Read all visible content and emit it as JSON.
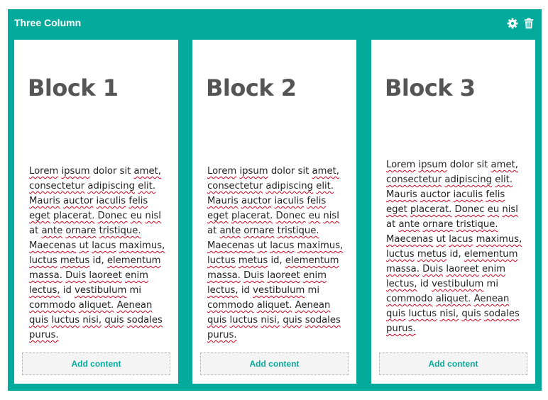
{
  "colors": {
    "accent": "#04ab9c",
    "spellcheck": "#d0021b"
  },
  "panel": {
    "title": "Three Column",
    "icons": [
      "gear-icon",
      "trash-icon"
    ]
  },
  "columns": [
    {
      "heading": "Block 1",
      "add_label": "Add content",
      "words": [
        "Lorem",
        "ipsum",
        "dolor",
        "sit",
        "amet,",
        "consectetur",
        "adipiscing",
        "elit.",
        "Mauris",
        "auctor",
        "iaculis",
        "felis",
        "eget",
        "placerat.",
        "Donec",
        "eu",
        "nisl",
        "at",
        "ante",
        "ornare",
        "tristique.",
        "Maecenas",
        "ut",
        "lacus",
        "maximus,",
        "luctus",
        "metus",
        "id,",
        "elementum",
        "massa.",
        "Duis",
        "laoreet",
        "enim",
        "lectus,",
        "id",
        "vestibulum",
        "mi",
        "commodo",
        "aliquet.",
        "Aenean",
        "quis",
        "luctus",
        "nisi,",
        "quis",
        "sodales",
        "purus."
      ]
    },
    {
      "heading": "Block 2",
      "add_label": "Add content",
      "words": [
        "Lorem",
        "ipsum",
        "dolor",
        "sit",
        "amet,",
        "consectetur",
        "adipiscing",
        "elit.",
        "Mauris",
        "auctor",
        "iaculis",
        "felis",
        "eget",
        "placerat.",
        "Donec",
        "eu",
        "nisl",
        "at",
        "ante",
        "ornare",
        "tristique.",
        "Maecenas",
        "ut",
        "lacus",
        "maximus,",
        "luctus",
        "metus",
        "id,",
        "elementum",
        "massa.",
        "Duis",
        "laoreet",
        "enim",
        "lectus,",
        "id",
        "vestibulum",
        "mi",
        "commodo",
        "aliquet.",
        "Aenean",
        "quis",
        "luctus",
        "nisi,",
        "quis",
        "sodales",
        "purus."
      ]
    },
    {
      "heading": "Block 3",
      "add_label": "Add content",
      "words": [
        "Lorem",
        "ipsum",
        "dolor",
        "sit",
        "amet,",
        "consectetur",
        "adipiscing",
        "elit.",
        "Mauris",
        "auctor",
        "iaculis",
        "felis",
        "eget",
        "placerat.",
        "Donec",
        "eu",
        "nisl",
        "at",
        "ante",
        "ornare",
        "tristique.",
        "Maecenas",
        "ut",
        "lacus",
        "maximus,",
        "luctus",
        "metus",
        "id,",
        "elementum",
        "massa.",
        "Duis",
        "laoreet",
        "enim",
        "lectus,",
        "id",
        "vestibulum",
        "mi",
        "commodo",
        "aliquet.",
        "Aenean",
        "quis",
        "luctus",
        "nisi,",
        "quis",
        "sodales",
        "purus."
      ]
    }
  ]
}
